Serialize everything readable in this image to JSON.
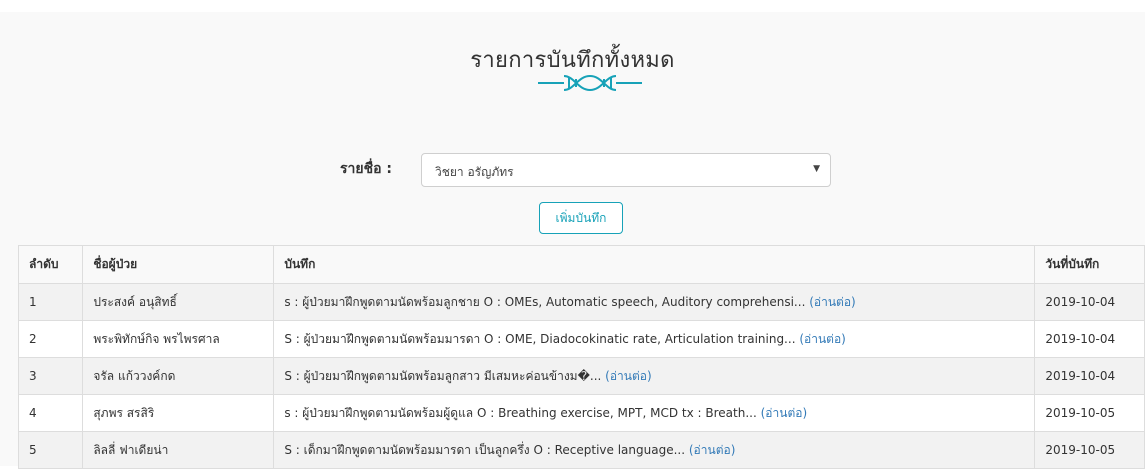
{
  "header": {
    "title": "รายการบันทึกทั้งหมด"
  },
  "filter": {
    "label": "รายชื่อ :",
    "selected": "วิชยา อรัญภัทร"
  },
  "actions": {
    "add_label": "เพิ่มบันทึก"
  },
  "table": {
    "columns": [
      "ลำดับ",
      "ชื่อผู้ป่วย",
      "บันทึก",
      "วันที่บันทึก"
    ],
    "read_more": "(อ่านต่อ)",
    "rows": [
      {
        "no": "1",
        "name": "ประสงค์ อนุสิทธิ์",
        "note": "s : ผู้ป่วยมาฝึกพูดตามนัดพร้อมลูกชาย O : OMEs, Automatic speech, Auditory comprehensi...",
        "date": "2019-10-04"
      },
      {
        "no": "2",
        "name": "พระพิทักษ์กิจ พรไพรศาล",
        "note": "S : ผู้ป่วยมาฝึกพูดตามนัดพร้อมมารดา O : OME, Diadocokinatic rate, Articulation training...",
        "date": "2019-10-04"
      },
      {
        "no": "3",
        "name": "จรัล แก้ววงค์กด",
        "note": "S : ผู้ป่วยมาฝึกพูดตามนัดพร้อมลูกสาว มีเสมหะค่อนข้างม�...",
        "date": "2019-10-04"
      },
      {
        "no": "4",
        "name": "สุภพร สรสิริ",
        "note": "s : ผู้ป่วยมาฝึกพูดตามนัดพร้อมผู้ดูแล O : Breathing exercise, MPT, MCD tx : Breath...",
        "date": "2019-10-05"
      },
      {
        "no": "5",
        "name": "ลิลลี่ ฟาเดียน่า",
        "note": "S : เด็กมาฝึกพูดตามนัดพร้อมมารดา เป็นลูกครึ่ง O : Receptive language...",
        "date": "2019-10-05"
      }
    ]
  },
  "colors": {
    "accent": "#17a2b8",
    "link": "#337ab7",
    "background": "#f9f9f9"
  }
}
